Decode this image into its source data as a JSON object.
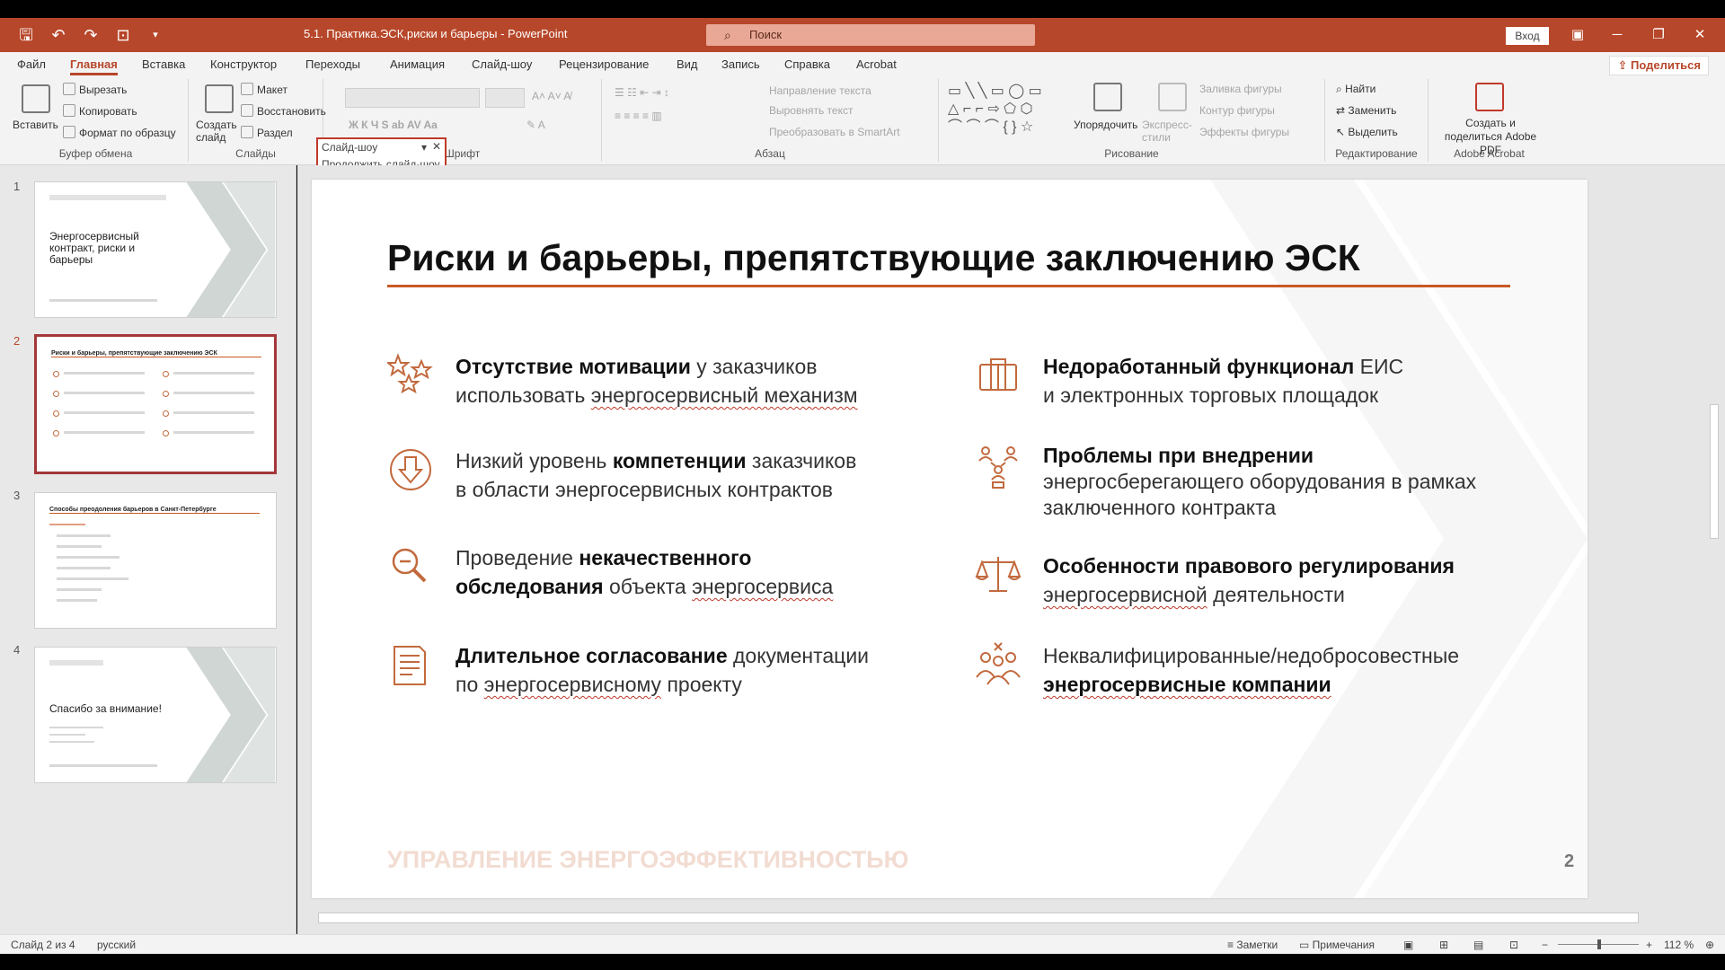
{
  "window": {
    "doc_title": "5.1. Практика.ЭСК,риски и барьеры  -  PowerPoint",
    "search_placeholder": "Поиск",
    "signin": "Вход"
  },
  "ribbon": {
    "tabs": [
      "Файл",
      "Главная",
      "Вставка",
      "Конструктор",
      "Переходы",
      "Анимация",
      "Слайд-шоу",
      "Рецензирование",
      "Вид",
      "Запись",
      "Справка",
      "Acrobat"
    ],
    "share": "Поделиться",
    "clipboard": {
      "label": "Буфер обмена",
      "paste": "Вставить",
      "cut": "Вырезать",
      "copy": "Копировать",
      "format": "Формат по образцу"
    },
    "slides": {
      "label": "Слайды",
      "new_slide": "Создать слайд",
      "layout": "Макет",
      "reset": "Восстановить",
      "section": "Раздел"
    },
    "font": {
      "label": "Шрифт"
    },
    "paragraph": {
      "label": "Абзац",
      "text_dir": "Направление текста",
      "align_text": "Выровнять текст",
      "smartart": "Преобразовать в SmartArt"
    },
    "drawing": {
      "label": "Рисование",
      "arrange": "Упорядочить",
      "quick_styles": "Экспресс-стили",
      "fill": "Заливка фигуры",
      "outline": "Контур фигуры",
      "effects": "Эффекты фигуры"
    },
    "editing": {
      "label": "Редактирование",
      "find": "Найти",
      "replace": "Заменить",
      "select": "Выделить"
    },
    "acrobat": {
      "label": "Adobe Acrobat",
      "create": "Создать и поделиться Adobe PDF"
    }
  },
  "popup": {
    "title": "Слайд-шоу",
    "action": "Продолжить слайд-шоу"
  },
  "thumbnails": [
    {
      "num": "1",
      "title": "Энергосервисный контракт, риски и барьеры"
    },
    {
      "num": "2",
      "title": "Риски и барьеры, препятствующие заключению ЭСК"
    },
    {
      "num": "3",
      "title": "Способы преодоления барьеров в Санкт-Петербурге"
    },
    {
      "num": "4",
      "title": "Спасибо за внимание!"
    }
  ],
  "slide": {
    "title": "Риски и барьеры, препятствующие заключению ЭСК",
    "footer": "УПРАВЛЕНИЕ ЭНЕРГОЭФФЕКТИВНОСТЬЮ",
    "number": "2",
    "left": [
      {
        "l1a": "Отсутствие мотивации",
        "l1b": " у заказчиков",
        "l2a": "использовать ",
        "l2b": "энергосервисный механизм"
      },
      {
        "l1a": "Низкий уровень ",
        "l1b": "компетенции",
        "l1c": " заказчиков",
        "l2": "в области энергосервисных контрактов"
      },
      {
        "l1a": "Проведение ",
        "l1b": "некачественного",
        "l2a": "обследования",
        "l2b": " объекта  ",
        "l2c": "энергосервиса"
      },
      {
        "l1a": "Длительное согласование",
        "l1b": " документации",
        "l2a": "по ",
        "l2b": "энергосервисному",
        "l2c": " проекту"
      }
    ],
    "right": [
      {
        "l1a": "Недоработанный функционал",
        "l1b": " ЕИС",
        "l2": "и электронных торговых площадок"
      },
      {
        "l1": "Проблемы при внедрении",
        "l2": "энергосберегающего оборудования в рамках",
        "l3": "заключенного контракта"
      },
      {
        "l1": "Особенности правового регулирования",
        "l2a": "энергосервисной",
        "l2b": " деятельности"
      },
      {
        "l1": "Неквалифицированные/недобросовестные",
        "l2": "энергосервисные компании"
      }
    ]
  },
  "status": {
    "slide_info": "Слайд 2 из 4",
    "language": "русский",
    "notes": "Заметки",
    "comments": "Примечания",
    "zoom": "112 %"
  },
  "colors": {
    "accent": "#b7472a",
    "slide_rule": "#c85a25",
    "icon": "#c26a3e"
  }
}
